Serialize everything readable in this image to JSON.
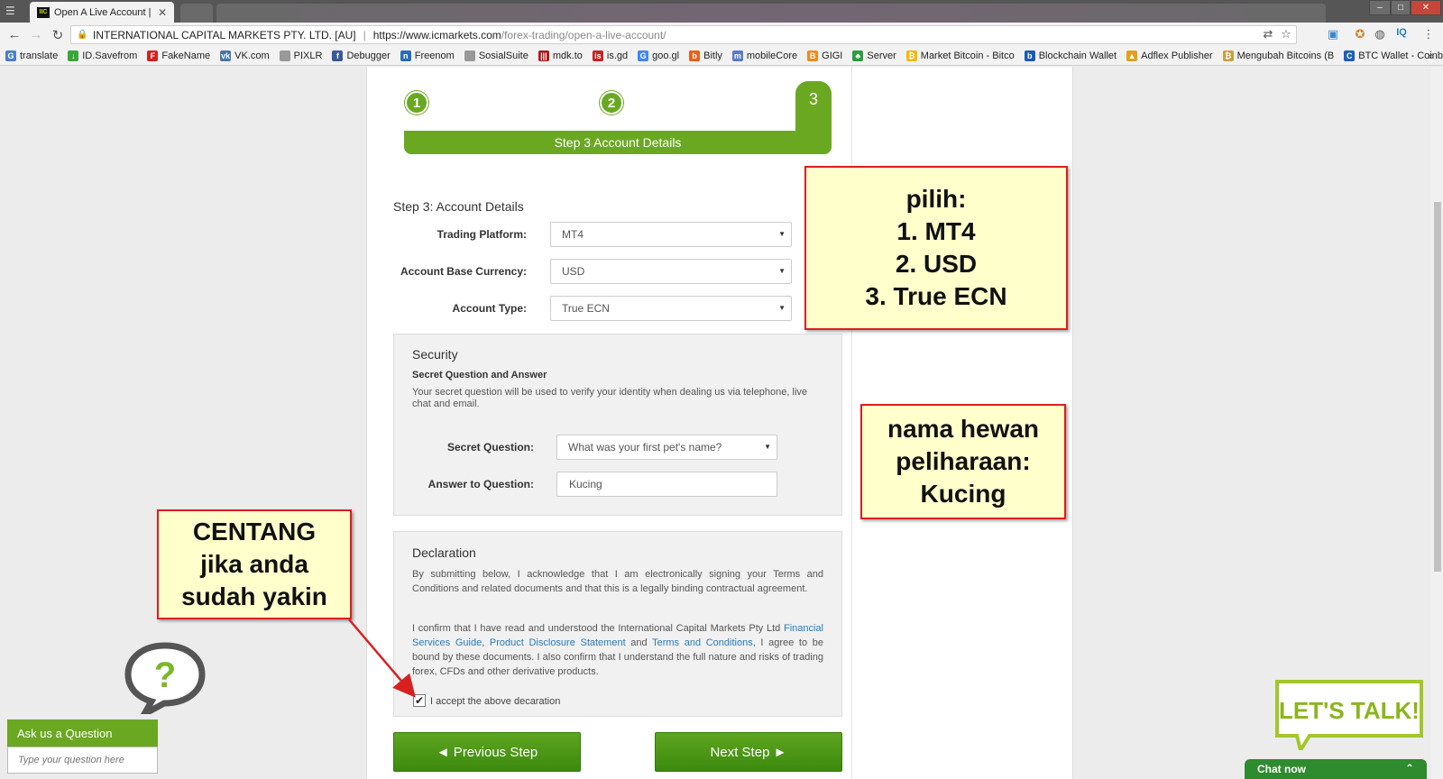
{
  "browser": {
    "tab_title": "Open A Live Account | Fo",
    "tab_close": "✕",
    "favicon_text": "IIC",
    "window_minimize": "–",
    "window_maximize": "□",
    "window_close": "✕",
    "org_name": "INTERNATIONAL CAPITAL MARKETS PTY. LTD. [AU]",
    "url_separator": "|",
    "url_host": "https://www.icmarkets.com",
    "url_path": "/forex-trading/open-a-live-account/",
    "bookmarks": [
      {
        "label": "translate",
        "color": "#4a7ec8",
        "glyph": "G"
      },
      {
        "label": "ID.Savefrom",
        "color": "#3aa63a",
        "glyph": "↓"
      },
      {
        "label": "FakeName",
        "color": "#d32020",
        "glyph": "F"
      },
      {
        "label": "VK.com",
        "color": "#4a76a8",
        "glyph": "vk"
      },
      {
        "label": "PIXLR",
        "color": "#999999",
        "glyph": ""
      },
      {
        "label": "Debugger",
        "color": "#3b5998",
        "glyph": "f"
      },
      {
        "label": "Freenom",
        "color": "#2a6eb0",
        "glyph": "n"
      },
      {
        "label": "SosialSuite",
        "color": "#999999",
        "glyph": ""
      },
      {
        "label": "mdk.to",
        "color": "#b01818",
        "glyph": "|||"
      },
      {
        "label": "is.gd",
        "color": "#c82020",
        "glyph": "is"
      },
      {
        "label": "goo.gl",
        "color": "#4285f4",
        "glyph": "G"
      },
      {
        "label": "Bitly",
        "color": "#e8601c",
        "glyph": "b"
      },
      {
        "label": "mobileCore",
        "color": "#5a7ac8",
        "glyph": "m"
      },
      {
        "label": "GIGI",
        "color": "#f08a24",
        "glyph": "B"
      },
      {
        "label": "Server",
        "color": "#2e9c3e",
        "glyph": "♣"
      },
      {
        "label": "Market Bitcoin - Bitco",
        "color": "#f0b90b",
        "glyph": "₿"
      },
      {
        "label": "Blockchain Wallet",
        "color": "#1e5cb0",
        "glyph": "b"
      },
      {
        "label": "Adflex Publisher",
        "color": "#e0a020",
        "glyph": "▲"
      },
      {
        "label": "Mengubah Bitcoins (B",
        "color": "#c8a040",
        "glyph": "₿"
      },
      {
        "label": "BTC Wallet - Coinbase",
        "color": "#1b5fb8",
        "glyph": "C"
      }
    ],
    "bookmarks_more": "»"
  },
  "stepper": {
    "step1": "1",
    "step2": "2",
    "step3": "3",
    "bar_label": "Step 3 Account Details"
  },
  "form": {
    "heading": "Step 3: Account Details",
    "trading_platform_label": "Trading Platform:",
    "trading_platform_value": "MT4",
    "currency_label": "Account Base Currency:",
    "currency_value": "USD",
    "account_type_label": "Account Type:",
    "account_type_value": "True ECN",
    "dropdown_arrow": "▼"
  },
  "security": {
    "title": "Security",
    "subtitle": "Secret Question and Answer",
    "description": "Your secret question will be used to verify your identity when dealing us via telephone, live chat and email.",
    "question_label": "Secret Question:",
    "question_value": "What was your first pet's name?",
    "answer_label": "Answer to Question:",
    "answer_value": "Kucing"
  },
  "declaration": {
    "title": "Declaration",
    "para1": "By submitting below, I acknowledge that I am electronically signing your Terms and Conditions and related documents and that this is a legally binding contractual agreement.",
    "para2_a": "I confirm that I have read and understood the International Capital Markets Pty Ltd ",
    "link1": "Financial Services Guide",
    "comma": ", ",
    "link2": "Product Disclosure Statement",
    "and": " and ",
    "link3": "Terms and Conditions",
    "para2_b": ", I agree to be bound by these documents. I also confirm that I understand the full nature and risks of trading forex, CFDs and other derivative products.",
    "checkbox_mark": "✔",
    "checkbox_label": "I accept the above decaration"
  },
  "buttons": {
    "previous": "◄ Previous Step",
    "next": "Next Step ►"
  },
  "annotations": {
    "note1": [
      "pilih:",
      "1. MT4",
      "2. USD",
      "3. True ECN"
    ],
    "note2": [
      "nama hewan",
      "peliharaan:",
      "Kucing"
    ],
    "note3": [
      "CENTANG",
      "jika anda",
      "sudah yakin"
    ],
    "arrow_color": "#d92020"
  },
  "widgets": {
    "ask_bubble_glyph": "?",
    "ask_header": "Ask us a Question",
    "ask_placeholder": "Type your question here",
    "lets_talk": "LET'S TALK!",
    "chat_now": "Chat now",
    "chat_chevron": "⌃"
  },
  "colors": {
    "brand_green": "#6aa822",
    "button_green": "#3c8a0f",
    "note_fill": "#ffffcc",
    "note_border": "#d92020",
    "link_blue": "#2a7ab8"
  }
}
